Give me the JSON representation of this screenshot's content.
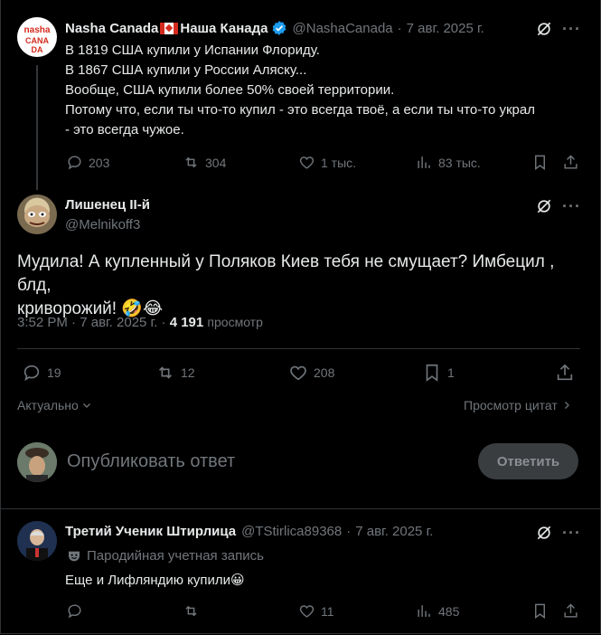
{
  "tweet1": {
    "author_name": "Nasha Canada",
    "author_name_ru": "Наша Канада",
    "handle": "@NashaCanada",
    "date": "7 авг. 2025 г.",
    "avatar_text": "nasha CANADA",
    "lines": [
      "В 1819 США купили у Испании Флориду.",
      "В 1867 США купили у России Аляску...",
      "Вообще, США купили более 50% своей территории.",
      "Потому что, если ты что-то купил - это всегда твоё, а если ты что-то украл",
      "- это всегда чужое."
    ],
    "replies": "203",
    "reposts": "304",
    "likes": "1 тыс.",
    "views": "83 тыс."
  },
  "tweet2": {
    "author_name": "Лишенец II-й",
    "handle": "@Melnikoff3",
    "text_line1": "Мудила! А купленный у Поляков Киев тебя не смущает? Имбецил , блд,",
    "text_line2": "криворожий! 🤣😂",
    "time": "3:52 PM",
    "date": "7 авг. 2025 г.",
    "views_count": "4 191",
    "views_label": "просмотр",
    "replies": "19",
    "reposts": "12",
    "likes": "208",
    "bookmarks": "1"
  },
  "sort": {
    "relevance_label": "Актуально",
    "quotes_label": "Просмотр цитат"
  },
  "reply_box": {
    "placeholder": "Опубликовать ответ",
    "button_label": "Ответить"
  },
  "tweet3": {
    "author_name": "Третий Ученик Штирлица",
    "handle": "@TStirlica89368",
    "date": "7 авг. 2025 г.",
    "parody_label": "Пародийная учетная запись",
    "text": "Еще и Лифляндию купили😀",
    "likes": "11",
    "views": "485"
  },
  "colors": {
    "accent": "#1d9bf0",
    "muted": "#71767b",
    "button_bg": "#3a3d40"
  }
}
